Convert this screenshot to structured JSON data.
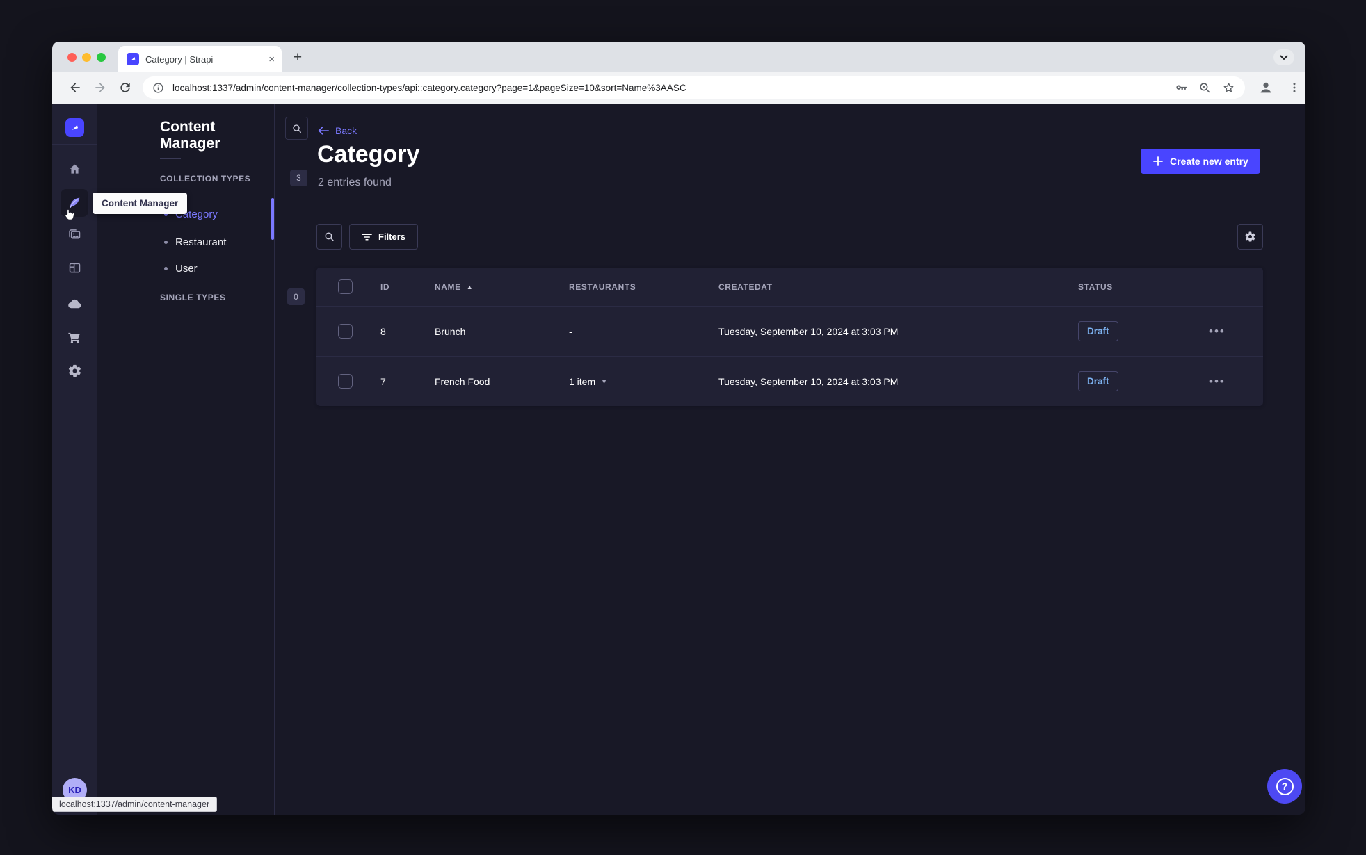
{
  "browser": {
    "tab_title": "Category | Strapi",
    "url": "localhost:1337/admin/content-manager/collection-types/api::category.category?page=1&pageSize=10&sort=Name%3AASC"
  },
  "subnav": {
    "title": "Content Manager",
    "collection_label": "COLLECTION TYPES",
    "collection_count": "3",
    "items": [
      {
        "label": "Category",
        "active": true
      },
      {
        "label": "Restaurant",
        "active": false
      },
      {
        "label": "User",
        "active": false
      }
    ],
    "single_label": "SINGLE TYPES",
    "single_count": "0"
  },
  "tooltip": {
    "text": "Content Manager"
  },
  "main": {
    "back_label": "Back",
    "title": "Category",
    "subtitle": "2 entries found",
    "create_label": "Create new entry",
    "filters_label": "Filters"
  },
  "table": {
    "headers": {
      "id": "ID",
      "name": "NAME",
      "restaurants": "RESTAURANTS",
      "created": "CREATEDAT",
      "status": "STATUS"
    },
    "rows": [
      {
        "id": "8",
        "name": "Brunch",
        "restaurants": "-",
        "created": "Tuesday, September 10, 2024 at 3:03 PM",
        "status": "Draft"
      },
      {
        "id": "7",
        "name": "French Food",
        "restaurants": "1 item",
        "created": "Tuesday, September 10, 2024 at 3:03 PM",
        "status": "Draft"
      }
    ]
  },
  "footer": {
    "initials": "KD",
    "status_url": "localhost:1337/admin/content-manager"
  },
  "icons": {
    "close": "×",
    "plus": "+",
    "sort_asc": "▲",
    "caret_down": "▼",
    "more": "•••",
    "help": "?"
  },
  "colors": {
    "primary": "#4945ff",
    "link": "#7b79ff",
    "draft_text": "#7db2f0",
    "page_bg": "#181826",
    "panel_bg": "#212134",
    "chrome_tabstrip": "#dee1e6"
  }
}
